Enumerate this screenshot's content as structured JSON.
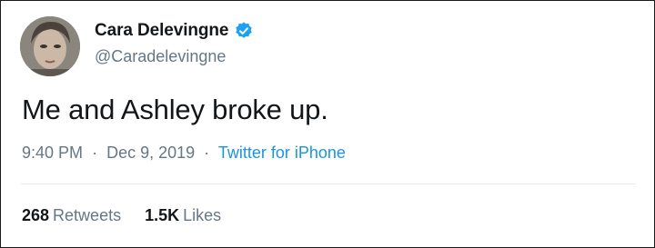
{
  "tweet": {
    "author_name": "Cara Delevingne",
    "author_handle": "@Caradelevingne",
    "text": "Me and Ashley broke up.",
    "time": "9:40 PM",
    "date": "Dec 9, 2019",
    "separator": "·",
    "source": "Twitter for iPhone",
    "retweets_count": "268",
    "retweets_label": "Retweets",
    "likes_count": "1.5K",
    "likes_label": "Likes"
  },
  "icons": {
    "verified": "verified-badge-icon",
    "avatar": "avatar-photo"
  },
  "colors": {
    "text": "#14171a",
    "muted": "#657786",
    "link": "#1b95e0",
    "verified": "#1da1f2"
  }
}
